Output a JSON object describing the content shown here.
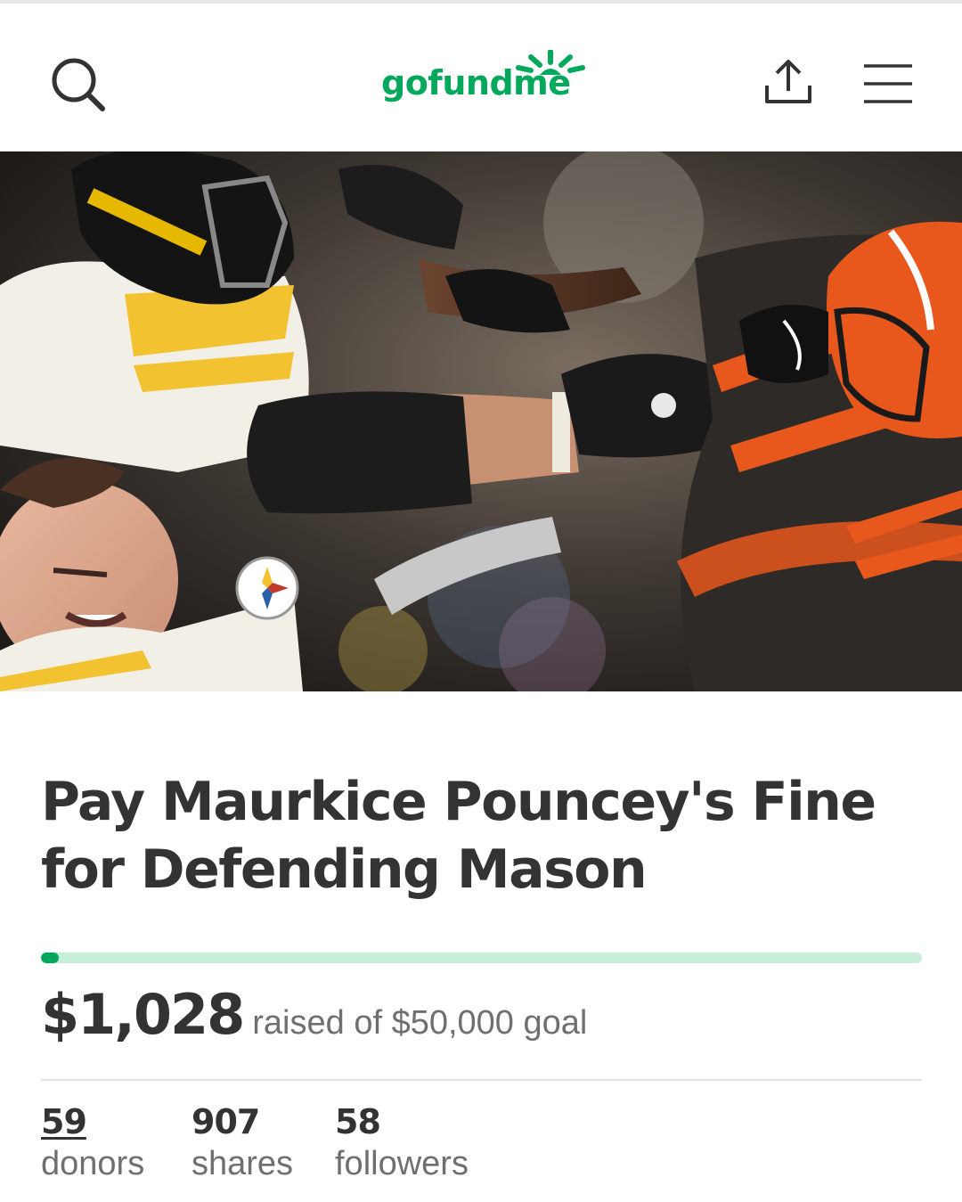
{
  "header": {
    "logo_text": "gofundme",
    "brand_color": "#02a95c",
    "icons": [
      "search-icon",
      "share-icon",
      "menu-icon"
    ]
  },
  "campaign": {
    "title_line1": "Pay Maurkice Pouncey's Fine",
    "title_line2": "for Defending Mason",
    "amount_raised": "$1,028",
    "raised_text": "raised of $50,000 goal",
    "progress_fraction": 0.02056
  },
  "stats": {
    "donors_count": "59",
    "donors_label": "donors",
    "shares_count": "907",
    "shares_label": "shares",
    "followers_count": "58",
    "followers_label": "followers"
  }
}
